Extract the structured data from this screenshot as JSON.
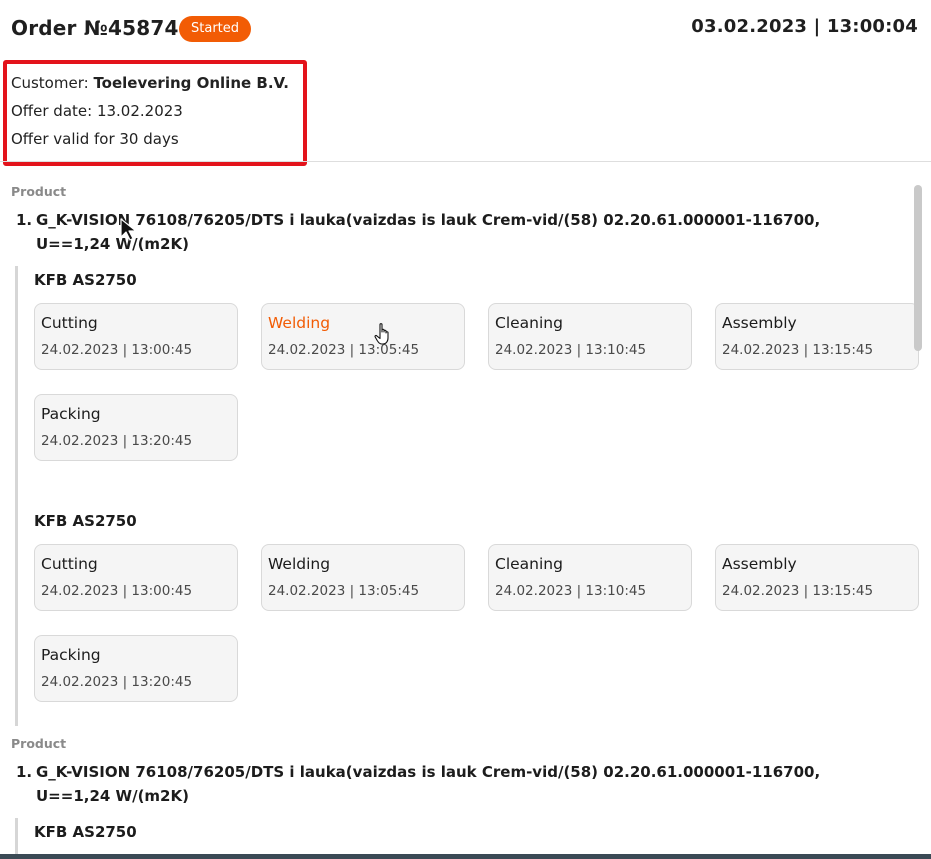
{
  "header": {
    "order_title": "Order №45874",
    "status": "Started",
    "datetime": "03.02.2023 | 13:00:04"
  },
  "customer": {
    "label": "Customer:",
    "name": "Toelevering Online B.V.",
    "offer_date": "Offer date: 13.02.2023",
    "validity": "Offer valid for 30 days"
  },
  "products": [
    {
      "section_label": "Product",
      "number": "1.",
      "name": "G_K-VISION 76108/76205/DTS i lauka(vaizdas is lauk Crem-vid/(58) 02.20.61.000001-116700, U==1,24 W/(m2K)",
      "groups": [
        {
          "title": "KFB AS2750",
          "steps": [
            {
              "name": "Cutting",
              "time": "24.02.2023 | 13:00:45"
            },
            {
              "name": "Welding",
              "time": "24.02.2023 | 13:05:45",
              "active": true
            },
            {
              "name": "Cleaning",
              "time": "24.02.2023 | 13:10:45"
            },
            {
              "name": "Assembly",
              "time": "24.02.2023 | 13:15:45"
            },
            {
              "name": "Packing",
              "time": "24.02.2023 | 13:20:45"
            }
          ]
        },
        {
          "title": "KFB AS2750",
          "steps": [
            {
              "name": "Cutting",
              "time": "24.02.2023 | 13:00:45"
            },
            {
              "name": "Welding",
              "time": "24.02.2023 | 13:05:45"
            },
            {
              "name": "Cleaning",
              "time": "24.02.2023 | 13:10:45"
            },
            {
              "name": "Assembly",
              "time": "24.02.2023 | 13:15:45"
            },
            {
              "name": "Packing",
              "time": "24.02.2023 | 13:20:45"
            }
          ]
        }
      ]
    },
    {
      "section_label": "Product",
      "number": "1.",
      "name": "G_K-VISION 76108/76205/DTS i lauka(vaizdas is lauk Crem-vid/(58) 02.20.61.000001-116700, U==1,24 W/(m2K)",
      "groups": [
        {
          "title": "KFB AS2750",
          "steps": []
        }
      ]
    }
  ],
  "colors": {
    "accent": "#f25c05",
    "highlight_border": "#e3131b",
    "card_bg": "#f5f5f5"
  },
  "icons": {
    "cursor": "arrow-pointer-icon",
    "hover": "hand-pointer-icon"
  }
}
